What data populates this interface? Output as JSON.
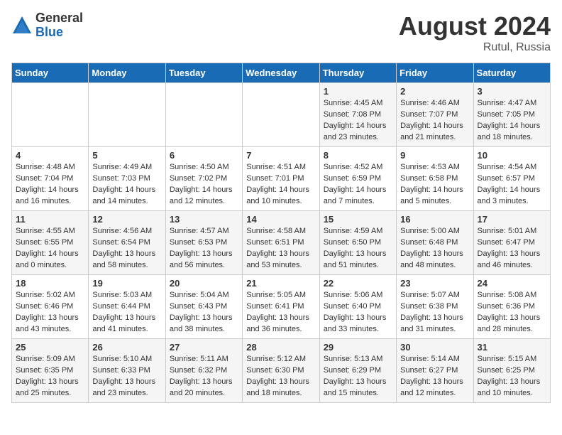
{
  "logo": {
    "general": "General",
    "blue": "Blue"
  },
  "title": "August 2024",
  "location": "Rutul, Russia",
  "weekdays": [
    "Sunday",
    "Monday",
    "Tuesday",
    "Wednesday",
    "Thursday",
    "Friday",
    "Saturday"
  ],
  "weeks": [
    [
      {
        "day": "",
        "content": ""
      },
      {
        "day": "",
        "content": ""
      },
      {
        "day": "",
        "content": ""
      },
      {
        "day": "",
        "content": ""
      },
      {
        "day": "1",
        "content": "Sunrise: 4:45 AM\nSunset: 7:08 PM\nDaylight: 14 hours\nand 23 minutes."
      },
      {
        "day": "2",
        "content": "Sunrise: 4:46 AM\nSunset: 7:07 PM\nDaylight: 14 hours\nand 21 minutes."
      },
      {
        "day": "3",
        "content": "Sunrise: 4:47 AM\nSunset: 7:05 PM\nDaylight: 14 hours\nand 18 minutes."
      }
    ],
    [
      {
        "day": "4",
        "content": "Sunrise: 4:48 AM\nSunset: 7:04 PM\nDaylight: 14 hours\nand 16 minutes."
      },
      {
        "day": "5",
        "content": "Sunrise: 4:49 AM\nSunset: 7:03 PM\nDaylight: 14 hours\nand 14 minutes."
      },
      {
        "day": "6",
        "content": "Sunrise: 4:50 AM\nSunset: 7:02 PM\nDaylight: 14 hours\nand 12 minutes."
      },
      {
        "day": "7",
        "content": "Sunrise: 4:51 AM\nSunset: 7:01 PM\nDaylight: 14 hours\nand 10 minutes."
      },
      {
        "day": "8",
        "content": "Sunrise: 4:52 AM\nSunset: 6:59 PM\nDaylight: 14 hours\nand 7 minutes."
      },
      {
        "day": "9",
        "content": "Sunrise: 4:53 AM\nSunset: 6:58 PM\nDaylight: 14 hours\nand 5 minutes."
      },
      {
        "day": "10",
        "content": "Sunrise: 4:54 AM\nSunset: 6:57 PM\nDaylight: 14 hours\nand 3 minutes."
      }
    ],
    [
      {
        "day": "11",
        "content": "Sunrise: 4:55 AM\nSunset: 6:55 PM\nDaylight: 14 hours\nand 0 minutes."
      },
      {
        "day": "12",
        "content": "Sunrise: 4:56 AM\nSunset: 6:54 PM\nDaylight: 13 hours\nand 58 minutes."
      },
      {
        "day": "13",
        "content": "Sunrise: 4:57 AM\nSunset: 6:53 PM\nDaylight: 13 hours\nand 56 minutes."
      },
      {
        "day": "14",
        "content": "Sunrise: 4:58 AM\nSunset: 6:51 PM\nDaylight: 13 hours\nand 53 minutes."
      },
      {
        "day": "15",
        "content": "Sunrise: 4:59 AM\nSunset: 6:50 PM\nDaylight: 13 hours\nand 51 minutes."
      },
      {
        "day": "16",
        "content": "Sunrise: 5:00 AM\nSunset: 6:48 PM\nDaylight: 13 hours\nand 48 minutes."
      },
      {
        "day": "17",
        "content": "Sunrise: 5:01 AM\nSunset: 6:47 PM\nDaylight: 13 hours\nand 46 minutes."
      }
    ],
    [
      {
        "day": "18",
        "content": "Sunrise: 5:02 AM\nSunset: 6:46 PM\nDaylight: 13 hours\nand 43 minutes."
      },
      {
        "day": "19",
        "content": "Sunrise: 5:03 AM\nSunset: 6:44 PM\nDaylight: 13 hours\nand 41 minutes."
      },
      {
        "day": "20",
        "content": "Sunrise: 5:04 AM\nSunset: 6:43 PM\nDaylight: 13 hours\nand 38 minutes."
      },
      {
        "day": "21",
        "content": "Sunrise: 5:05 AM\nSunset: 6:41 PM\nDaylight: 13 hours\nand 36 minutes."
      },
      {
        "day": "22",
        "content": "Sunrise: 5:06 AM\nSunset: 6:40 PM\nDaylight: 13 hours\nand 33 minutes."
      },
      {
        "day": "23",
        "content": "Sunrise: 5:07 AM\nSunset: 6:38 PM\nDaylight: 13 hours\nand 31 minutes."
      },
      {
        "day": "24",
        "content": "Sunrise: 5:08 AM\nSunset: 6:36 PM\nDaylight: 13 hours\nand 28 minutes."
      }
    ],
    [
      {
        "day": "25",
        "content": "Sunrise: 5:09 AM\nSunset: 6:35 PM\nDaylight: 13 hours\nand 25 minutes."
      },
      {
        "day": "26",
        "content": "Sunrise: 5:10 AM\nSunset: 6:33 PM\nDaylight: 13 hours\nand 23 minutes."
      },
      {
        "day": "27",
        "content": "Sunrise: 5:11 AM\nSunset: 6:32 PM\nDaylight: 13 hours\nand 20 minutes."
      },
      {
        "day": "28",
        "content": "Sunrise: 5:12 AM\nSunset: 6:30 PM\nDaylight: 13 hours\nand 18 minutes."
      },
      {
        "day": "29",
        "content": "Sunrise: 5:13 AM\nSunset: 6:29 PM\nDaylight: 13 hours\nand 15 minutes."
      },
      {
        "day": "30",
        "content": "Sunrise: 5:14 AM\nSunset: 6:27 PM\nDaylight: 13 hours\nand 12 minutes."
      },
      {
        "day": "31",
        "content": "Sunrise: 5:15 AM\nSunset: 6:25 PM\nDaylight: 13 hours\nand 10 minutes."
      }
    ]
  ]
}
